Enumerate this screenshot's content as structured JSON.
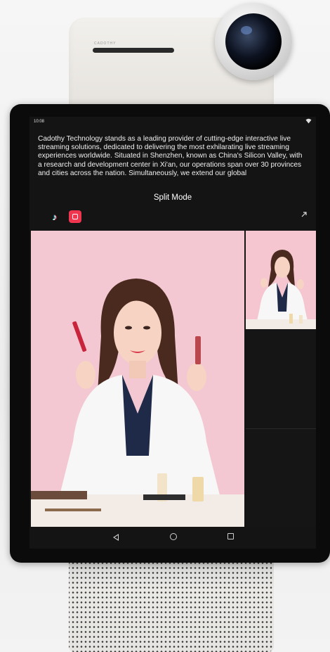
{
  "device": {
    "brand_label": "CADOTHY"
  },
  "status_bar": {
    "time": "10:08",
    "wifi_icon": "wifi-icon"
  },
  "description": "Cadothy Technology stands as a leading provider of cutting-edge interactive live streaming solutions, dedicated to delivering the most exhilarating live streaming experiences worldwide. Situated in Shenzhen, known as China's Silicon Valley, with a research and development center in Xi'an, our operations span over 30 provinces and cities across the nation. Simultaneously, we extend our global",
  "mode": {
    "title": "Split Mode"
  },
  "apps": [
    {
      "icon": "tiktok-icon"
    },
    {
      "icon": "red-app-icon"
    }
  ],
  "colors": {
    "screen_bg": "#141414",
    "video_bg": "#f4c8d2",
    "accent_red": "#f0364f"
  },
  "nav_icons": [
    "back-icon",
    "home-icon",
    "recents-icon"
  ]
}
